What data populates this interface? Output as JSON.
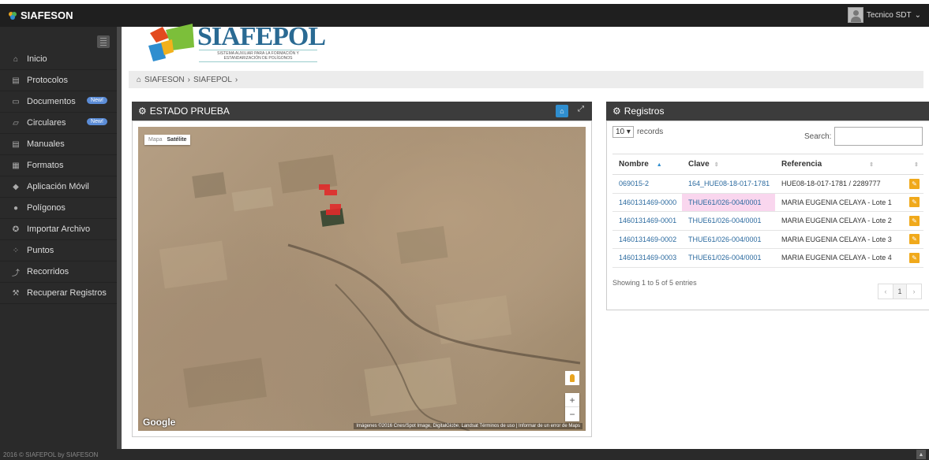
{
  "app": {
    "brand": "SIAFESON",
    "user_name": "Tecnico SDT",
    "footer": "2016 © SIAFEPOL by SIAFESON"
  },
  "sidebar": {
    "items": [
      {
        "label": "Inicio",
        "icon": "home-icon",
        "glyph": "⌂"
      },
      {
        "label": "Protocolos",
        "icon": "book-icon",
        "glyph": "▤"
      },
      {
        "label": "Documentos",
        "icon": "folder-icon",
        "glyph": "▭",
        "badge": "New!"
      },
      {
        "label": "Circulares",
        "icon": "folder-open-icon",
        "glyph": "▱",
        "badge": "New!"
      },
      {
        "label": "Manuales",
        "icon": "book-icon",
        "glyph": "▤"
      },
      {
        "label": "Formatos",
        "icon": "file-icon",
        "glyph": "▦"
      },
      {
        "label": "Aplicación Móvil",
        "icon": "mobile-icon",
        "glyph": "◆"
      },
      {
        "label": "Polígonos",
        "icon": "polygon-icon",
        "glyph": "●"
      },
      {
        "label": "Importar Archivo",
        "icon": "import-icon",
        "glyph": "✪"
      },
      {
        "label": "Puntos",
        "icon": "points-icon",
        "glyph": "⁘"
      },
      {
        "label": "Recorridos",
        "icon": "route-icon",
        "glyph": "⤴"
      },
      {
        "label": "Recuperar Registros",
        "icon": "wrench-icon",
        "glyph": "⚒"
      }
    ]
  },
  "logo": {
    "title": "SIAFEPOL",
    "subtitle": "SISTEMA AUXILIAR PARA LA FORMACIÓN Y ESTANDARIZACIÓN DE POLÍGONOS"
  },
  "breadcrumb": {
    "home": "SIAFESON",
    "sep1": "›",
    "current": "SIAFEPOL",
    "sep2": "›"
  },
  "map_panel": {
    "title": "ESTADO PRUEBA",
    "maptype_map": "Mapa",
    "maptype_sat": "Satélite",
    "google": "Google",
    "credit": "Imágenes ©2016 Cnes/Spot Image, DigitalGlobe, Landsat  Términos de uso  |  Informar de un error de Maps",
    "zoom_in": "+",
    "zoom_out": "−"
  },
  "records": {
    "title": "Registros",
    "length_value": "10",
    "length_label": "records",
    "search_label": "Search:",
    "columns": [
      "Nombre",
      "Clave",
      "Referencia"
    ],
    "rows": [
      {
        "nombre": "069015-2",
        "clave": "164_HUE08-18-017-1781",
        "referencia": "HUE08-18-017-1781 / 2289777"
      },
      {
        "nombre": "1460131469-0000",
        "clave": "THUE61/026-004/0001",
        "referencia": "MARIA EUGENIA CELAYA - Lote 1"
      },
      {
        "nombre": "1460131469-0001",
        "clave": "THUE61/026-004/0001",
        "referencia": "MARIA EUGENIA CELAYA - Lote 2"
      },
      {
        "nombre": "1460131469-0002",
        "clave": "THUE61/026-004/0001",
        "referencia": "MARIA EUGENIA CELAYA - Lote 3"
      },
      {
        "nombre": "1460131469-0003",
        "clave": "THUE61/026-004/0001",
        "referencia": "MARIA EUGENIA CELAYA - Lote 4"
      }
    ],
    "info": "Showing 1 to 5 of 5 entries",
    "page_prev": "‹",
    "page_current": "1",
    "page_next": "›"
  }
}
